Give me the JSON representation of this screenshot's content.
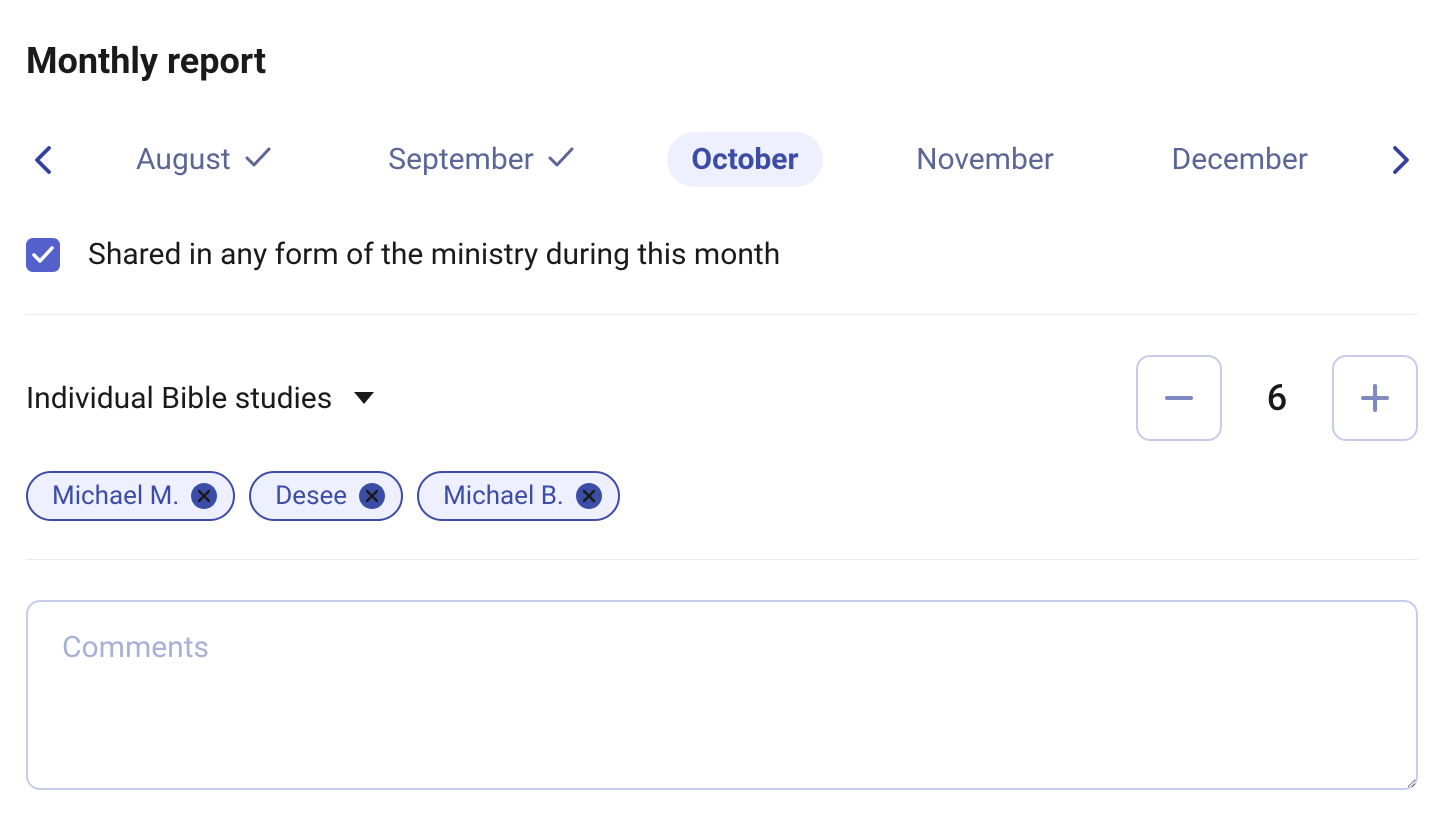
{
  "header": {
    "title": "Monthly report"
  },
  "months": {
    "items": [
      {
        "label": "August",
        "completed": true,
        "selected": false
      },
      {
        "label": "September",
        "completed": true,
        "selected": false
      },
      {
        "label": "October",
        "completed": false,
        "selected": true
      },
      {
        "label": "November",
        "completed": false,
        "selected": false
      },
      {
        "label": "December",
        "completed": false,
        "selected": false
      }
    ]
  },
  "shared": {
    "checked": true,
    "label": "Shared in any form of the ministry during this month"
  },
  "studies": {
    "label": "Individual Bible studies",
    "value": "6",
    "people": [
      {
        "name": "Michael M."
      },
      {
        "name": "Desee"
      },
      {
        "name": "Michael B."
      }
    ]
  },
  "comments": {
    "placeholder": "Comments",
    "value": ""
  }
}
